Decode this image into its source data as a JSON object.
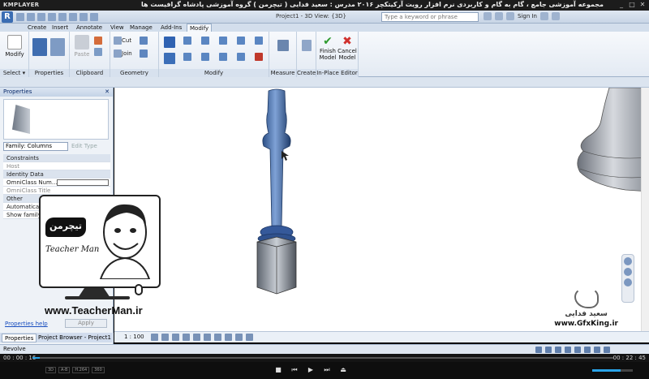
{
  "player": {
    "logo": "KMPLAYER",
    "title": "مجموعه آموزشی جامع ، گام به گام و کاربردی نرم افزار رویت آرکیتکچر ۲۰۱۶ مدرس : سعید فدایی ( تیچرمن ) گروه آموزشی پادشاه گرافیست ها",
    "time_elapsed": "00 : 00 : 16",
    "time_total": "00 : 22 : 45",
    "progress": 0.012,
    "volume": 0.7,
    "badges": [
      "3D",
      "A-B",
      "H.264",
      "360"
    ]
  },
  "revit": {
    "app_letter": "R",
    "doc_title": "Project1 - 3D View: {3D}",
    "search_placeholder": "Type a keyword or phrase",
    "sign_in": "Sign In",
    "tabs": [
      "Create",
      "Insert",
      "Annotate",
      "View",
      "Manage",
      "Add-Ins",
      "Modify"
    ],
    "active_tab": "Modify",
    "panels": {
      "select": "Select ▾",
      "properties": "Properties",
      "clipboard": "Clipboard",
      "geometry": "Geometry",
      "modify": "Modify",
      "measure": "Measure ▾",
      "create": "Create",
      "inplace": "In-Place Editor"
    },
    "buttons": {
      "modify": "Modify",
      "paste": "Paste",
      "cut": "Cut",
      "join": "Join",
      "finish_model": "Finish Model",
      "cancel_model": "Cancel Model"
    }
  },
  "properties": {
    "title": "Properties",
    "family_select": "Family: Columns",
    "edit_type": "Edit Type",
    "rows": [
      {
        "group": true,
        "label": "Constraints"
      },
      {
        "label": "Host",
        "dim": true
      },
      {
        "group": true,
        "label": "Identity Data"
      },
      {
        "label": "OmniClass Num..."
      },
      {
        "label": "OmniClass Title",
        "dim": true
      },
      {
        "group": true,
        "label": "Other"
      },
      {
        "label": "Automatically joi..."
      },
      {
        "label": "Show family pre..."
      }
    ],
    "help_link": "Properties help",
    "apply": "Apply",
    "bottom_tabs": [
      "Properties",
      "Project Browser - Project1"
    ]
  },
  "overlay": {
    "tm_logo": "تیچرمن",
    "tm_name": "Teacher Man",
    "tm_url": "www.TeacherMan.ir",
    "gfx_name": "سعید فدایی",
    "gfx_url": "www.GfxKing.ir"
  },
  "viewport": {
    "scale": "1 : 100"
  },
  "status_bar": {
    "text": "Revolve"
  }
}
